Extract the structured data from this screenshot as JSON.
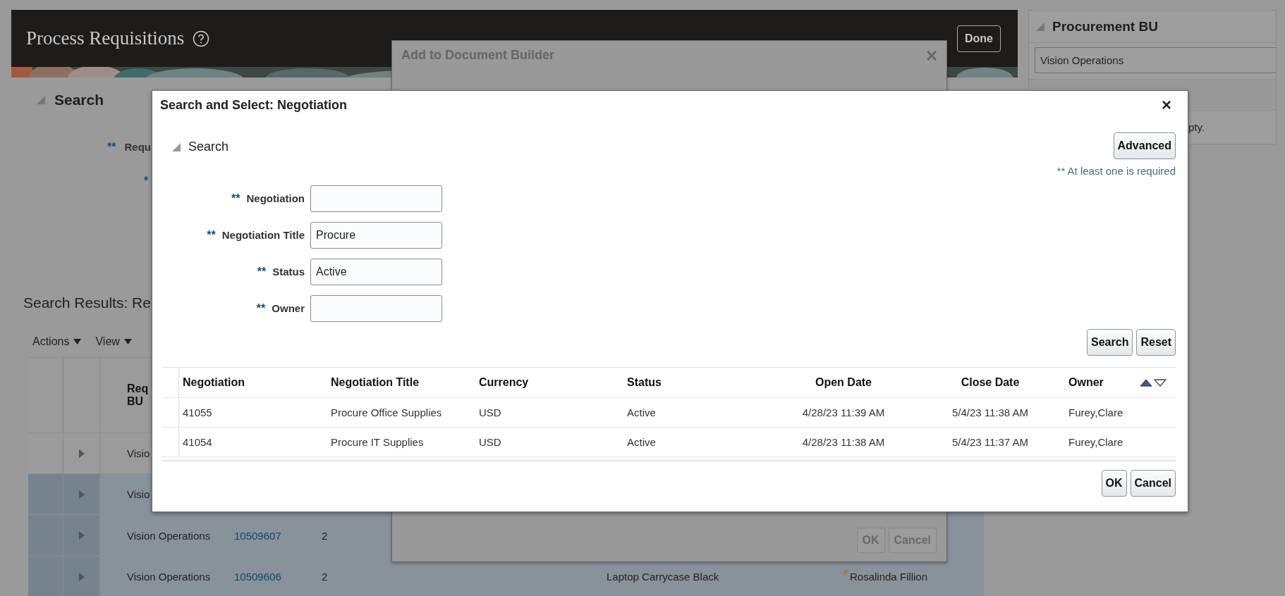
{
  "page": {
    "title": "Process Requisitions",
    "done_button": "Done",
    "search_section": {
      "label": "Search",
      "expanded": true
    },
    "search_fields": [
      {
        "required_mark": "**",
        "label": "Requ"
      },
      {
        "required_mark": "*"
      }
    ],
    "results_title": "Search Results: Re",
    "toolbar": [
      "Actions",
      "View"
    ],
    "table": {
      "columns": [
        "Req BU"
      ],
      "rows": [
        {
          "selected": false,
          "bu": "Visio"
        },
        {
          "selected": true,
          "bu": "Visio"
        },
        {
          "selected": true,
          "bu": "Vision Operations",
          "requisition": "10509607",
          "line": "2"
        },
        {
          "selected": true,
          "bu": "Vision Operations",
          "requisition": "10509606",
          "line": "2",
          "item": "Laptop Carrycase Black",
          "requester": "Rosalinda Fillion"
        }
      ]
    }
  },
  "side_panel": {
    "section": {
      "label": "Procurement BU",
      "expanded": true
    },
    "field_value": "Vision Operations",
    "note": "pty."
  },
  "back_dialog": {
    "title": "Add to Document Builder",
    "buttons": [
      "OK",
      "Cancel"
    ]
  },
  "dialog": {
    "title": "Search and Select: Negotiation",
    "close": "×",
    "search_section": {
      "label": "Search",
      "expanded": true
    },
    "advanced_button": "Advanced",
    "required_note": "** At least one is required",
    "fields": [
      {
        "required_mark": "**",
        "label": "Negotiation"
      },
      {
        "required_mark": "**",
        "label": "Negotiation Title",
        "value": "Procure"
      },
      {
        "required_mark": "**",
        "label": "Status",
        "value": "Active"
      },
      {
        "required_mark": "**",
        "label": "Owner"
      }
    ],
    "search_buttons": [
      "Search",
      "Reset"
    ],
    "table": {
      "columns": [
        "Negotiation",
        "Negotiation Title",
        "Currency",
        "Status",
        "Open Date",
        "Close Date",
        "Owner"
      ],
      "rows": [
        [
          "41055",
          "Procure Office Supplies",
          "USD",
          "Active",
          "4/28/23 11:39 AM",
          "5/4/23 11:38 AM",
          "Furey,Clare"
        ],
        [
          "41054",
          "Procure IT Supplies",
          "USD",
          "Active",
          "4/28/23 11:38 AM",
          "5/4/23 11:37 AM",
          "Furey,Clare"
        ]
      ]
    },
    "buttons": [
      "OK",
      "Cancel"
    ]
  }
}
